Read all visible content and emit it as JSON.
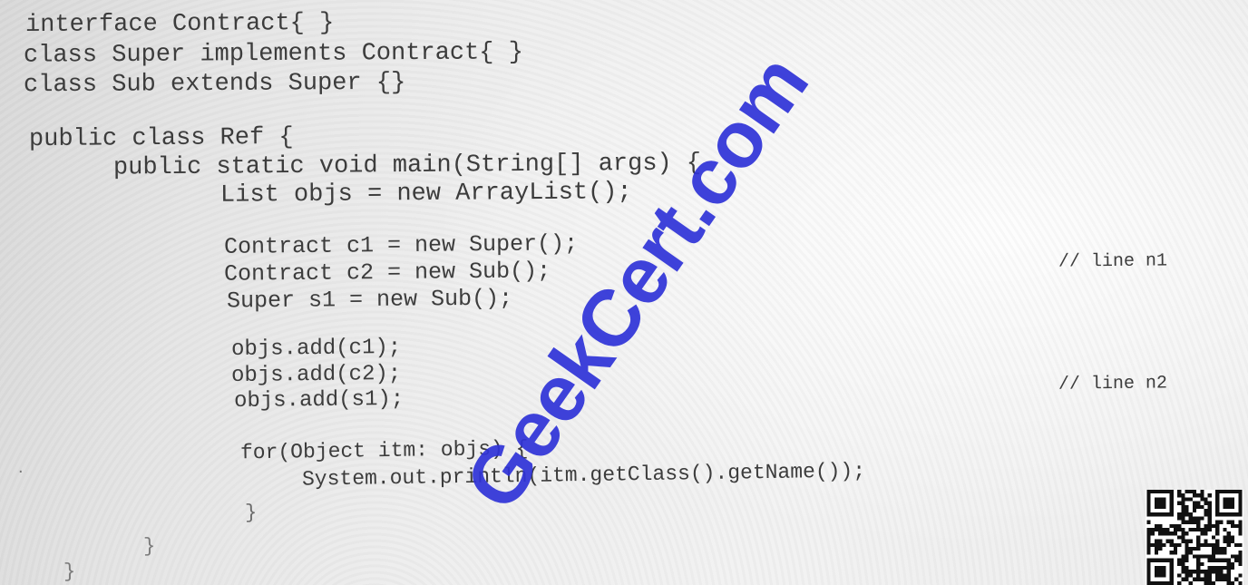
{
  "code": {
    "lines": [
      "interface Contract{ }",
      "class Super implements Contract{ }",
      "class Sub extends Super {}",
      "public class Ref {",
      "public static void main(String[] args) {",
      "List objs = new ArrayList();",
      "Contract c1 = new Super();",
      "Contract c2 = new Sub();",
      "Super s1 = new Sub();",
      "objs.add(c1);",
      "objs.add(c2);",
      "objs.add(s1);",
      "for(Object itm: objs) {",
      "System.out.println(itm.getClass().getName());",
      "}",
      "}",
      "}"
    ],
    "comments": {
      "n1": "// line n1",
      "n2": "// line n2"
    }
  },
  "watermark": {
    "text": "GeekCert.com",
    "color": "#2f33d8"
  },
  "qr_code": {
    "icon": "qr-code-icon"
  }
}
